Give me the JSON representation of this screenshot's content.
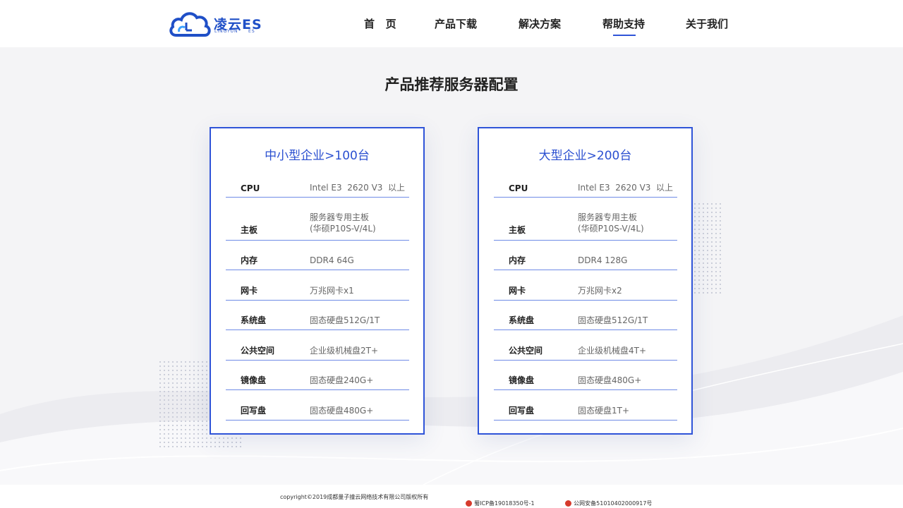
{
  "brand": {
    "name": "凌云ES",
    "subtitle": "LINGYUN     ES"
  },
  "nav": {
    "items": [
      {
        "label": "首   页"
      },
      {
        "label": "产品下载"
      },
      {
        "label": "解决方案"
      },
      {
        "label": "帮助支持",
        "active": true
      },
      {
        "label": "关于我们"
      }
    ]
  },
  "page_title": "产品推荐服务器配置",
  "cards": [
    {
      "title": "中小型企业>100台",
      "specs": [
        {
          "label": "CPU",
          "value": "Intel E3  2620 V3  以上"
        },
        {
          "label": "主板",
          "value": "服务器专用主板\n(华硕P10S-V/4L)"
        },
        {
          "label": "内存",
          "value": "DDR4 64G"
        },
        {
          "label": "网卡",
          "value": "万兆网卡x1"
        },
        {
          "label": "系统盘",
          "value": "固态硬盘512G/1T"
        },
        {
          "label": "公共空间",
          "value": "企业级机械盘2T+"
        },
        {
          "label": "镜像盘",
          "value": "固态硬盘240G+"
        },
        {
          "label": "回写盘",
          "value": "固态硬盘480G+"
        }
      ]
    },
    {
      "title": "大型企业>200台",
      "specs": [
        {
          "label": "CPU",
          "value": "Intel E3  2620 V3  以上"
        },
        {
          "label": "主板",
          "value": "服务器专用主板\n(华硕P10S-V/4L)"
        },
        {
          "label": "内存",
          "value": "DDR4 128G"
        },
        {
          "label": "网卡",
          "value": "万兆网卡x2"
        },
        {
          "label": "系统盘",
          "value": "固态硬盘512G/1T"
        },
        {
          "label": "公共空间",
          "value": "企业级机械盘4T+"
        },
        {
          "label": "镜像盘",
          "value": "固态硬盘480G+"
        },
        {
          "label": "回写盘",
          "value": "固态硬盘1T+"
        }
      ]
    }
  ],
  "footer": {
    "copyright": "copyright©2019成都量子撞云网络技术有限公司版权所有",
    "icp": "蜀ICP备19018350号-1",
    "police": "公网安备51010402000917号"
  },
  "colors": {
    "accent": "#2f54d8",
    "brand": "#1f4fc7"
  }
}
